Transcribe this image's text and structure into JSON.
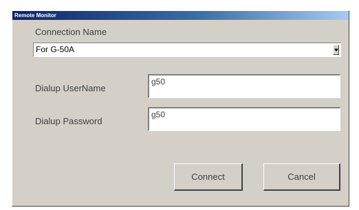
{
  "window": {
    "title": "Remote Monitor"
  },
  "connection": {
    "label": "Connection Name",
    "selected": "For G-50A"
  },
  "username": {
    "label": "Dialup UserName",
    "value": "g50"
  },
  "password": {
    "label": "Dialup Password",
    "value": "g50"
  },
  "buttons": {
    "connect": "Connect",
    "cancel": "Cancel"
  },
  "icons": {
    "dropdown": "chevron-down-icon"
  }
}
